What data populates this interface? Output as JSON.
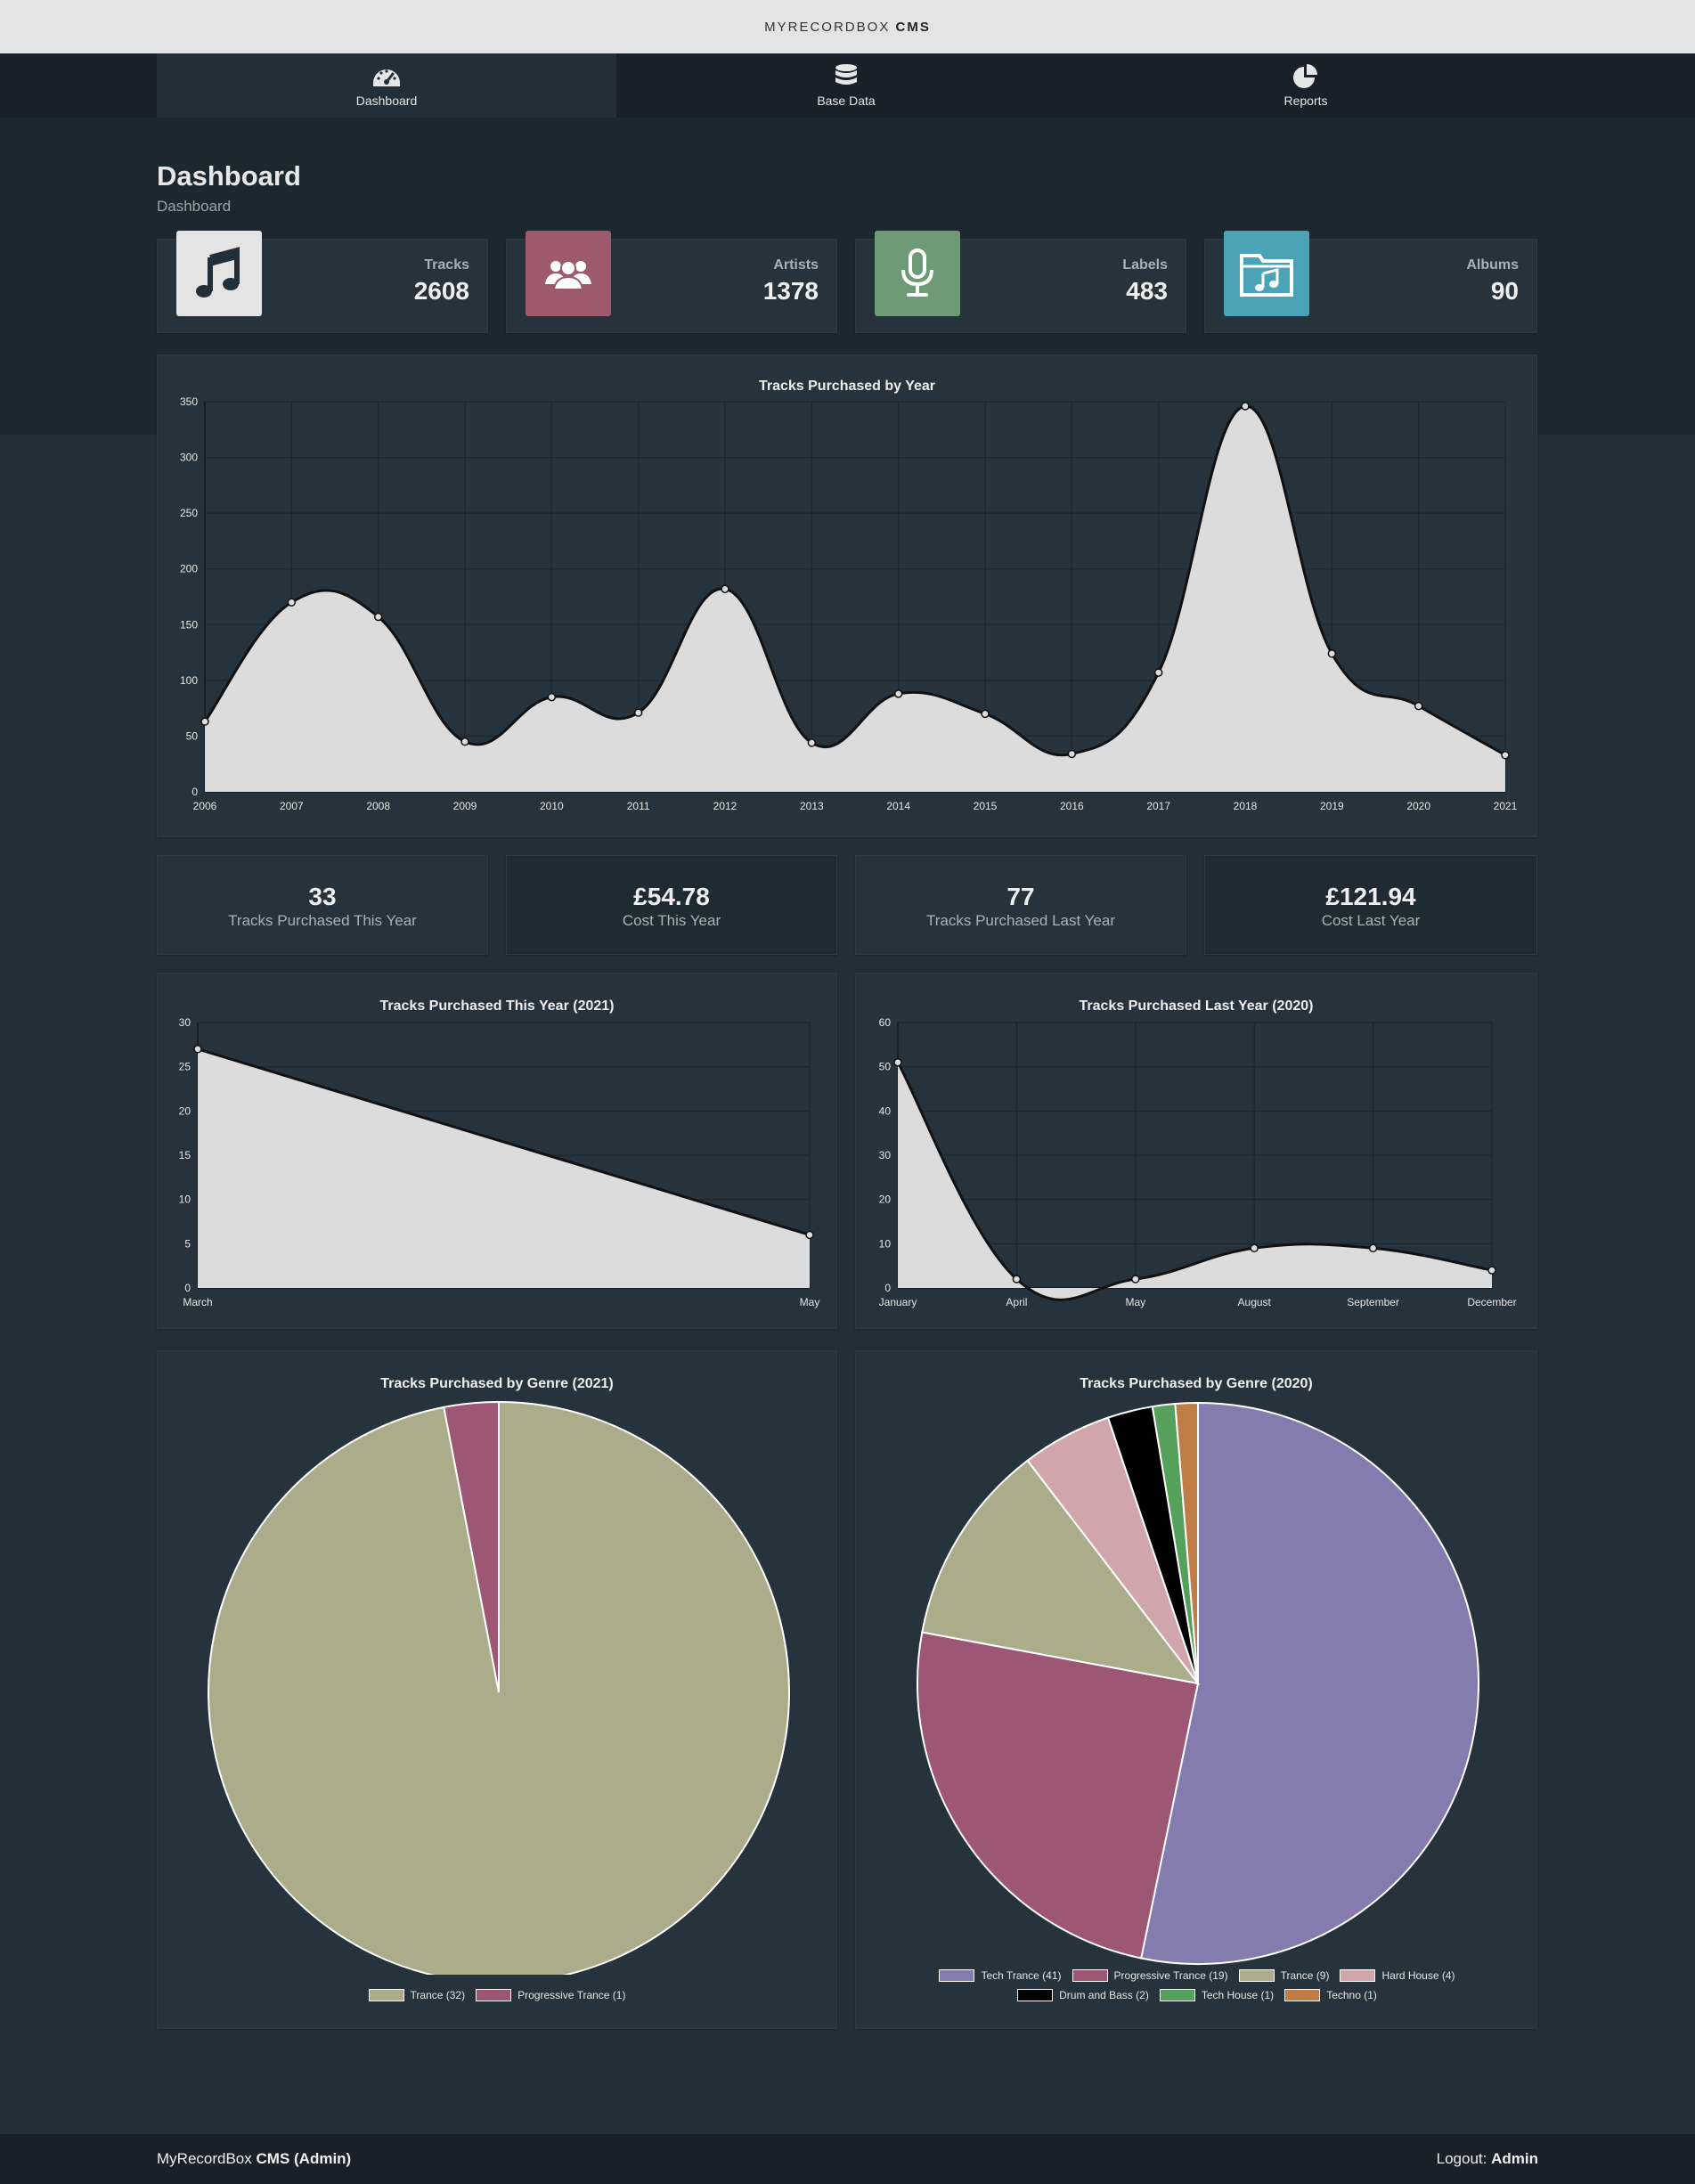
{
  "app": {
    "brand_light": "MYRECORDBOX",
    "brand_bold": "CMS"
  },
  "nav": [
    {
      "label": "Dashboard",
      "icon": "dashboard-gauge-icon",
      "active": true
    },
    {
      "label": "Base Data",
      "icon": "database-icon",
      "active": false
    },
    {
      "label": "Reports",
      "icon": "pie-chart-icon",
      "active": false
    }
  ],
  "page": {
    "title": "Dashboard",
    "breadcrumb": "Dashboard"
  },
  "stats": [
    {
      "label": "Tracks",
      "value": "2608",
      "icon": "music-note-icon",
      "color": "#e4e4e4"
    },
    {
      "label": "Artists",
      "value": "1378",
      "icon": "users-icon",
      "color": "#9d5a6c"
    },
    {
      "label": "Labels",
      "value": "483",
      "icon": "microphone-icon",
      "color": "#6e9b76"
    },
    {
      "label": "Albums",
      "value": "90",
      "icon": "music-folder-icon",
      "color": "#4aa3b7"
    }
  ],
  "kpis": [
    {
      "value": "33",
      "label": "Tracks Purchased This Year"
    },
    {
      "value": "£54.78",
      "label": "Cost This Year"
    },
    {
      "value": "77",
      "label": "Tracks Purchased Last Year"
    },
    {
      "value": "£121.94",
      "label": "Cost Last Year"
    }
  ],
  "footer": {
    "app_light": "MyRecordBox",
    "app_bold": "CMS (Admin)",
    "logout_label": "Logout:",
    "user": "Admin"
  },
  "chart_data": [
    {
      "type": "area",
      "title": "Tracks Purchased by Year",
      "x": [
        "2006",
        "2007",
        "2008",
        "2009",
        "2010",
        "2011",
        "2012",
        "2013",
        "2014",
        "2015",
        "2016",
        "2017",
        "2018",
        "2019",
        "2020",
        "2021"
      ],
      "values": [
        63,
        170,
        157,
        45,
        85,
        71,
        182,
        44,
        88,
        70,
        34,
        107,
        346,
        124,
        77,
        33
      ],
      "ylim": [
        0,
        350
      ],
      "yticks": [
        0,
        50,
        100,
        150,
        200,
        250,
        300,
        350
      ],
      "grid": true
    },
    {
      "type": "area",
      "title": "Tracks Purchased This Year (2021)",
      "x": [
        "March",
        "May"
      ],
      "values": [
        27,
        6
      ],
      "ylim": [
        0,
        30
      ],
      "yticks": [
        0,
        5,
        10,
        15,
        20,
        25,
        30
      ],
      "grid": true
    },
    {
      "type": "area",
      "title": "Tracks Purchased Last Year (2020)",
      "x": [
        "January",
        "April",
        "May",
        "August",
        "September",
        "December"
      ],
      "values": [
        51,
        2,
        2,
        9,
        9,
        4
      ],
      "ylim": [
        0,
        60
      ],
      "yticks": [
        0,
        10,
        20,
        30,
        40,
        50,
        60
      ],
      "grid": true
    },
    {
      "type": "pie",
      "title": "Tracks Purchased by Genre (2021)",
      "slices": [
        {
          "label": "Trance (32)",
          "value": 32,
          "color": "#abad8a"
        },
        {
          "label": "Progressive Trance (1)",
          "value": 1,
          "color": "#9d5674"
        }
      ],
      "legend": "bottom"
    },
    {
      "type": "pie",
      "title": "Tracks Purchased by Genre (2020)",
      "slices": [
        {
          "label": "Tech Trance (41)",
          "value": 41,
          "color": "#847caf"
        },
        {
          "label": "Progressive Trance (19)",
          "value": 19,
          "color": "#9d5674"
        },
        {
          "label": "Trance (9)",
          "value": 9,
          "color": "#abad8a"
        },
        {
          "label": "Hard House (4)",
          "value": 4,
          "color": "#d0a6ab"
        },
        {
          "label": "Drum and Bass (2)",
          "value": 2,
          "color": "#000000"
        },
        {
          "label": "Tech House (1)",
          "value": 1,
          "color": "#55a05a"
        },
        {
          "label": "Techno (1)",
          "value": 1,
          "color": "#c07c45"
        }
      ],
      "legend": "bottom"
    }
  ]
}
